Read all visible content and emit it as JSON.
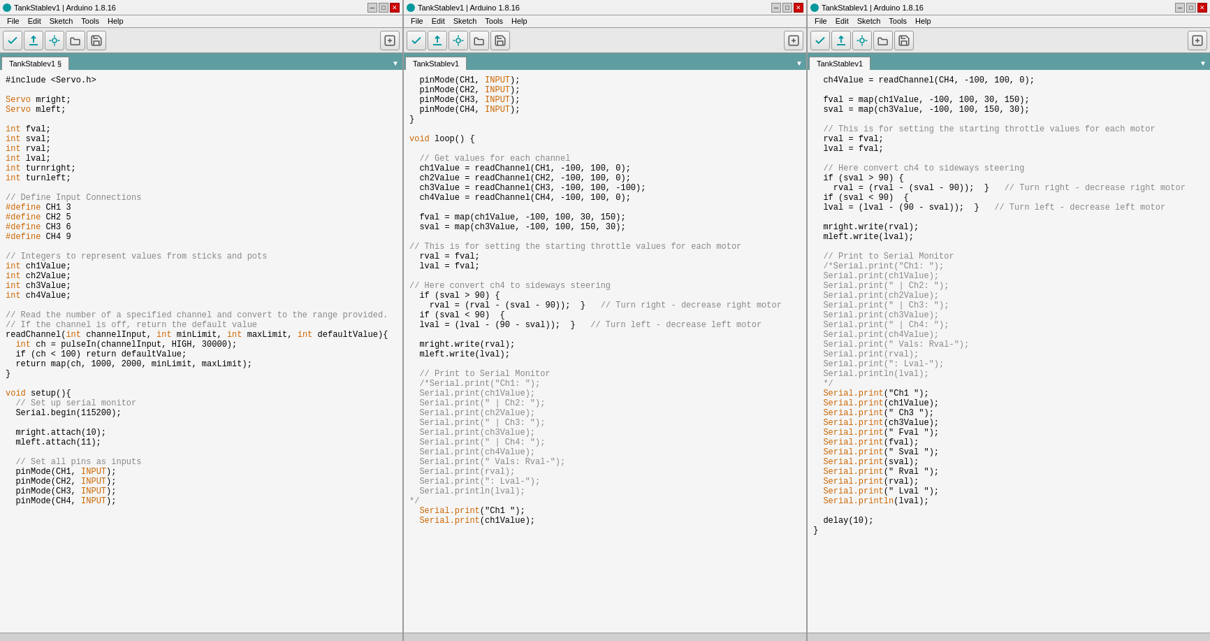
{
  "app": {
    "title": "TankStablev1 | Arduino 1.8.16"
  },
  "panes": [
    {
      "id": "pane1",
      "title": "TankStablev1 | Arduino 1.8.16",
      "tab_label": "TankStablev1 §",
      "tab_active": true,
      "menu": [
        "File",
        "Edit",
        "Sketch",
        "Tools",
        "Help"
      ],
      "code": [
        {
          "type": "plain",
          "text": "#include <Servo.h>"
        },
        {
          "type": "plain",
          "text": ""
        },
        {
          "type": "orange",
          "text": "Servo"
        },
        {
          "type": "plain",
          "text": " mright;"
        },
        {
          "type": "orange",
          "text": "Servo"
        },
        {
          "type": "plain",
          "text": " mleft;"
        },
        {
          "type": "plain",
          "text": ""
        },
        {
          "type": "orange",
          "text": "int"
        },
        {
          "type": "plain",
          "text": " fval;"
        },
        {
          "type": "orange",
          "text": "int"
        },
        {
          "type": "plain",
          "text": " sval;"
        },
        {
          "type": "orange",
          "text": "int"
        },
        {
          "type": "plain",
          "text": " rval;"
        },
        {
          "type": "orange",
          "text": "int"
        },
        {
          "type": "plain",
          "text": " lval;"
        },
        {
          "type": "orange",
          "text": "int"
        },
        {
          "type": "plain",
          "text": " turnright;"
        },
        {
          "type": "orange",
          "text": "int"
        },
        {
          "type": "plain",
          "text": " turnleft;"
        },
        {
          "type": "plain",
          "text": ""
        },
        {
          "type": "comment",
          "text": "// Define Input Connections"
        },
        {
          "type": "orange",
          "text": "#define"
        },
        {
          "type": "plain",
          "text": " CH1 3"
        },
        {
          "type": "orange",
          "text": "#define"
        },
        {
          "type": "plain",
          "text": " CH2 5"
        },
        {
          "type": "orange",
          "text": "#define"
        },
        {
          "type": "plain",
          "text": " CH3 6"
        },
        {
          "type": "orange",
          "text": "#define"
        },
        {
          "type": "plain",
          "text": " CH4 9"
        },
        {
          "type": "plain",
          "text": ""
        },
        {
          "type": "comment",
          "text": "// Integers to represent values from sticks and pots"
        },
        {
          "type": "orange",
          "text": "int"
        },
        {
          "type": "plain",
          "text": " ch1Value;"
        },
        {
          "type": "orange",
          "text": "int"
        },
        {
          "type": "plain",
          "text": " ch2Value;"
        },
        {
          "type": "orange",
          "text": "int"
        },
        {
          "type": "plain",
          "text": " ch3Value;"
        },
        {
          "type": "orange",
          "text": "int"
        },
        {
          "type": "plain",
          "text": " ch4Value;"
        },
        {
          "type": "plain",
          "text": ""
        },
        {
          "type": "comment",
          "text": "// Read the number of a specified channel and convert to the range provided."
        },
        {
          "type": "comment",
          "text": "// If the channel is off, return the default value"
        },
        {
          "type": "plain",
          "text": "readChannel("
        },
        {
          "type": "orange",
          "text": "int"
        },
        {
          "type": "plain",
          "text": " channelInput, "
        },
        {
          "type": "orange",
          "text": "int"
        },
        {
          "type": "plain",
          "text": " minLimit, "
        },
        {
          "type": "orange",
          "text": "int"
        },
        {
          "type": "plain",
          "text": " maxLimit, "
        },
        {
          "type": "orange",
          "text": "int"
        },
        {
          "type": "plain",
          "text": " defaultValue){"
        },
        {
          "type": "plain",
          "text": "  int ch = pulseIn(channelInput, HIGH, 30000);"
        },
        {
          "type": "plain",
          "text": "  if (ch < 100) return defaultValue;"
        },
        {
          "type": "plain",
          "text": "  return map(ch, 1000, 2000, minLimit, maxLimit);"
        },
        {
          "type": "plain",
          "text": "}"
        },
        {
          "type": "plain",
          "text": ""
        },
        {
          "type": "orange",
          "text": "void"
        },
        {
          "type": "plain",
          "text": " setup(){"
        },
        {
          "type": "comment",
          "text": "  // Set up serial monitor"
        },
        {
          "type": "plain",
          "text": "  Serial.begin(115200);"
        },
        {
          "type": "plain",
          "text": ""
        },
        {
          "type": "plain",
          "text": "  mright.attach(10);"
        },
        {
          "type": "plain",
          "text": "  mleft.attach(11);"
        },
        {
          "type": "plain",
          "text": ""
        },
        {
          "type": "comment",
          "text": "  // Set all pins as inputs"
        },
        {
          "type": "plain",
          "text": "  pinMode(CH1, "
        },
        {
          "type": "orange",
          "text": "INPUT"
        },
        {
          "type": "plain",
          "text": ");"
        },
        {
          "type": "plain",
          "text": "  pinMode(CH2, "
        },
        {
          "type": "orange",
          "text": "INPUT"
        },
        {
          "type": "plain",
          "text": ");"
        },
        {
          "type": "plain",
          "text": "  pinMode(CH3, "
        },
        {
          "type": "orange",
          "text": "INPUT"
        },
        {
          "type": "plain",
          "text": ");"
        },
        {
          "type": "plain",
          "text": "  pinMode(CH4, "
        },
        {
          "type": "orange",
          "text": "INPUT"
        },
        {
          "type": "plain",
          "text": ");"
        }
      ]
    },
    {
      "id": "pane2",
      "title": "TankStablev1 | Arduino 1.8.16",
      "tab_label": "TankStablev1",
      "tab_active": true,
      "menu": [
        "File",
        "Edit",
        "Sketch",
        "Tools",
        "Help"
      ]
    },
    {
      "id": "pane3",
      "title": "TankStablev1 | Arduino 1.8.16",
      "tab_label": "TankStablev1",
      "tab_active": true,
      "menu": [
        "File",
        "Edit",
        "Sketch",
        "Tools",
        "Help"
      ]
    }
  ],
  "toolbar": {
    "buttons": [
      "verify",
      "upload",
      "debug",
      "open",
      "save",
      "serial"
    ]
  },
  "pane1_code_text": "#include <Servo.h>\n\nServo mright;\nServo mleft;\n\nint fval;\nint sval;\nint rval;\nint lval;\nint turnright;\nint turnleft;\n\n// Define Input Connections\n#define CH1 3\n#define CH2 5\n#define CH3 6\n#define CH4 9\n\n// Integers to represent values from sticks and pots\nint ch1Value;\nint ch2Value;\nint ch3Value;\nint ch4Value;\n\n// Read the number of a specified channel and convert to the range provided.\n// If the channel is off, return the default value\nreadChannel(int channelInput, int minLimit, int maxLimit, int defaultValue){\n  int ch = pulseIn(channelInput, HIGH, 30000);\n  if (ch < 100) return defaultValue;\n  return map(ch, 1000, 2000, minLimit, maxLimit);\n}\n\nvoid setup(){\n  // Set up serial monitor\n  Serial.begin(115200);\n\n  mright.attach(10);\n  mleft.attach(11);\n\n  // Set all pins as inputs\n  pinMode(CH1, INPUT);\n  pinMode(CH2, INPUT);\n  pinMode(CH3, INPUT);\n  pinMode(CH4, INPUT);",
  "pane2_code_text": "  pinMode(CH1, INPUT);\n  pinMode(CH2, INPUT);\n  pinMode(CH3, INPUT);\n  pinMode(CH4, INPUT);\n}\n\nvoid loop() {\n\n  // Get values for each channel\n  ch1Value = readChannel(CH1, -100, 100, 0);\n  ch2Value = readChannel(CH2, -100, 100, 0);\n  ch3Value = readChannel(CH3, -100, 100, -100);\n  ch4Value = readChannel(CH4, -100, 100, 0);\n\n  fval = map(ch1Value, -100, 100, 30, 150);\n  sval = map(ch3Value, -100, 100, 150, 30);\n\n// This is for setting the starting throttle values for each motor\n  rval = fval;\n  lval = fval;\n\n// Here convert ch4 to sideways steering\n  if (sval > 90) {\n    rval = (rval - (sval - 90));  }   // Turn right - decrease right motor\n  if (sval < 90)  {\n  lval = (lval - (90 - sval));  }   // Turn left - decrease left motor\n\n  mright.write(rval);\n  mleft.write(lval);\n\n  // Print to Serial Monitor\n  /*Serial.print(\"Ch1: \");\n  Serial.print(ch1Value);\n  Serial.print(\" | Ch2: \");\n  Serial.print(ch2Value);\n  Serial.print(\" | Ch3: \");\n  Serial.print(ch3Value);\n  Serial.print(\" | Ch4: \");\n  Serial.print(ch4Value);\n  Serial.print(\" Vals: Rval-\");\n  Serial.print(rval);\n  Serial.print(\": Lval-\");\n  Serial.println(lval);\n*/\n  Serial.print(\"Ch1 \");\n  Serial.print(ch1Value);",
  "pane3_code_text": "  ch4Value = readChannel(CH4, -100, 100, 0);\n\n  fval = map(ch1Value, -100, 100, 30, 150);\n  sval = map(ch3Value, -100, 100, 150, 30);\n\n  // This is for setting the starting throttle values for each motor\n  rval = fval;\n  lval = fval;\n\n  // Here convert ch4 to sideways steering\n  if (sval > 90) {\n    rval = (rval - (sval - 90));  }   // Turn right - decrease right motor\n  if (sval < 90)  {\n  lval = (lval - (90 - sval));  }   // Turn left - decrease left motor\n\n  mright.write(rval);\n  mleft.write(lval);\n\n  // Print to Serial Monitor\n  /*Serial.print(\"Ch1: \");\n  Serial.print(ch1Value);\n  Serial.print(\" | Ch2: \");\n  Serial.print(ch2Value);\n  Serial.print(\" | Ch3: \");\n  Serial.print(ch3Value);\n  Serial.print(\" | Ch4: \");\n  Serial.print(ch4Value);\n  Serial.print(\" Vals: Rval-\");\n  Serial.print(rval);\n  Serial.print(\": Lval-\");\n  Serial.println(lval);\n  */\n  Serial.print(\"Ch1 \");\n  Serial.print(ch1Value);\n  Serial.print(\" Ch3 \");\n  Serial.print(ch3Value);\n  Serial.print(\" Fval \");\n  Serial.print(fval);\n  Serial.print(\" Sval \");\n  Serial.print(sval);\n  Serial.print(\" Rval \");\n  Serial.print(rval);\n  Serial.print(\" Lval \");\n  Serial.println(lval);\n\n  delay(10);\n}"
}
